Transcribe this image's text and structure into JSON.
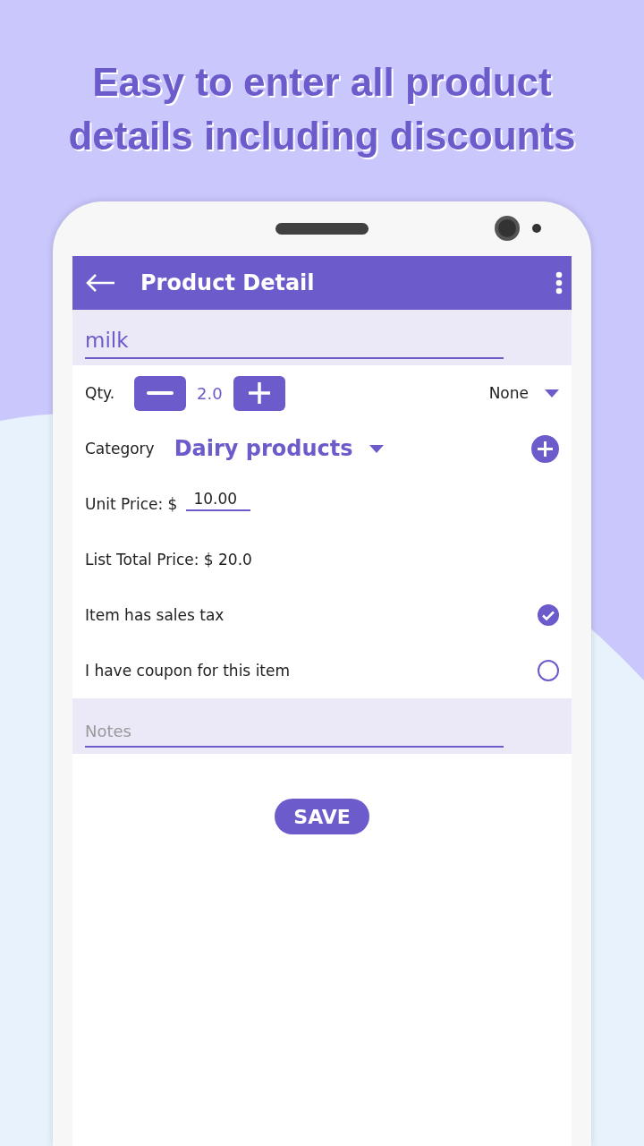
{
  "headline_lines": [
    "Easy to enter all product",
    "details including discounts"
  ],
  "toolbar": {
    "title": "Product Detail"
  },
  "name_field": {
    "value": "milk"
  },
  "quantity": {
    "label": "Qty.",
    "value": "2.0",
    "unit": "None"
  },
  "category": {
    "label": "Category",
    "value": "Dairy products"
  },
  "unit_price": {
    "label": "Unit Price: $",
    "value": "10.00"
  },
  "total": "List Total Price: $ 20.0",
  "options": [
    {
      "label": "Item has sales tax",
      "checked": true
    },
    {
      "label": "I have coupon for this item",
      "checked": false
    }
  ],
  "notes": {
    "placeholder": "Notes"
  },
  "save_button": "SAVE"
}
